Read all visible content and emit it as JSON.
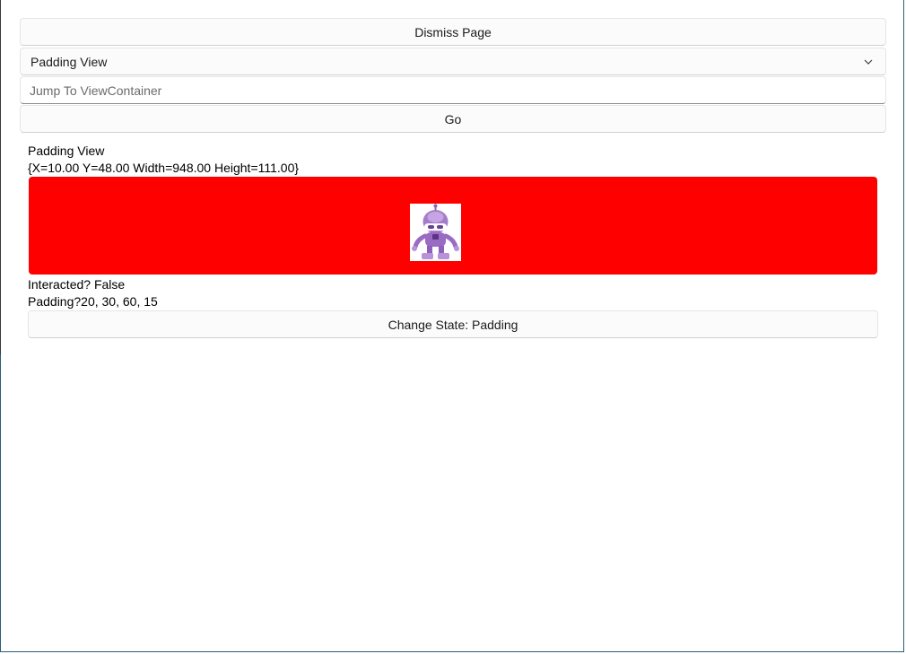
{
  "controls": {
    "dismiss_label": "Dismiss Page",
    "page_picker_value": "Padding View",
    "jump_placeholder": "Jump To ViewContainer",
    "go_label": "Go"
  },
  "content": {
    "title": "Padding View",
    "bounds": "{X=10.00 Y=48.00 Width=948.00 Height=111.00}",
    "panel_color": "#ff0000",
    "interacted": "Interacted? False",
    "padding": "Padding?20, 30, 60, 15",
    "change_state_label": "Change State: Padding"
  },
  "icons": {
    "combo_chevron": "chevron-down-icon",
    "image": "dotnet-bot-icon"
  }
}
